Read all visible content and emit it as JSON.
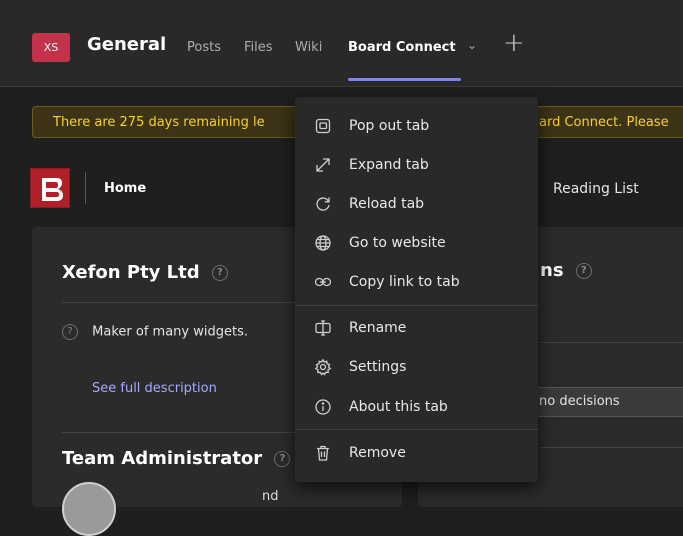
{
  "header": {
    "team_initials": "XS",
    "channel": "General",
    "tabs": [
      "Posts",
      "Files",
      "Wiki",
      "Board Connect"
    ],
    "active_tab": "Board Connect",
    "accent": "#7f85f5"
  },
  "banner": {
    "left_text": "There are 275 days remaining le",
    "right_text": "ard Connect. Please"
  },
  "app": {
    "logo": "B",
    "home": "Home",
    "reading_list": "Reading List"
  },
  "left_panel": {
    "company": "Xefon Pty Ltd",
    "description": "Maker of many widgets.",
    "see_full": "See full description",
    "team_admin": "Team Administrator",
    "admin_partial": "nd"
  },
  "right_panel": {
    "title_fragment": "ns",
    "decisions_fragment": "no decisions"
  },
  "context_menu": {
    "items": [
      {
        "label": "Pop out tab",
        "icon": "pop-out-icon"
      },
      {
        "label": "Expand tab",
        "icon": "expand-icon"
      },
      {
        "label": "Reload tab",
        "icon": "reload-icon"
      },
      {
        "label": "Go to website",
        "icon": "globe-icon"
      },
      {
        "label": "Copy link to tab",
        "icon": "link-icon"
      },
      {
        "label": "Rename",
        "icon": "rename-icon"
      },
      {
        "label": "Settings",
        "icon": "gear-icon"
      },
      {
        "label": "About this tab",
        "icon": "info-icon"
      },
      {
        "label": "Remove",
        "icon": "trash-icon"
      }
    ]
  }
}
